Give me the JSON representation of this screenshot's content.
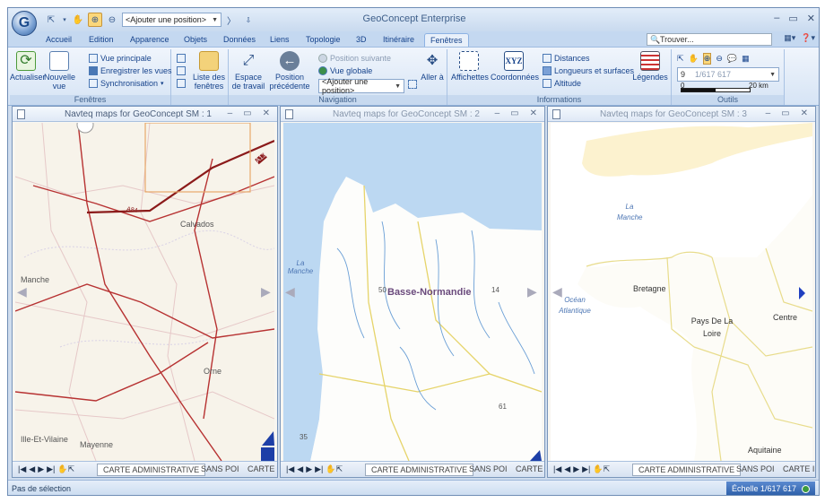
{
  "app": {
    "title": "GeoConcept Enterprise",
    "orb_letter": "G"
  },
  "qat": {
    "position_combo": "<Ajouter une position>"
  },
  "tabs": [
    "Accueil",
    "Edition",
    "Apparence",
    "Objets",
    "Données",
    "Liens",
    "Topologie",
    "3D",
    "Itinéraire",
    "Fenêtres"
  ],
  "active_tab": "Fenêtres",
  "search": {
    "placeholder": "Trouver..."
  },
  "ribbon": {
    "fenetres": {
      "label": "Fenêtres",
      "actualiser": "Actualiser",
      "nouvelle_vue": "Nouvelle vue",
      "vue_principale": "Vue principale",
      "enregistrer_vues": "Enregistrer les vues",
      "synchronisation": "Synchronisation",
      "liste_fenetres": "Liste des fenêtres"
    },
    "navigation": {
      "label": "Navigation",
      "espace_travail": "Espace de travail",
      "position_precedente": "Position précédente",
      "position_suivante": "Position suivante",
      "vue_globale": "Vue globale",
      "position_combo": "<Ajouter une position>",
      "aller_a": "Aller à"
    },
    "informations": {
      "label": "Informations",
      "affichettes": "Affichettes",
      "coordonnees": "Coordonnées",
      "xyz": "XYZ",
      "distances": "Distances",
      "longueurs_surfaces": "Longueurs et surfaces",
      "altitude": "Altitude",
      "legendes": "Légendes"
    },
    "outils": {
      "label": "Outils",
      "zoom_level": "9",
      "scale": "1/617 617",
      "scale_zero": "0",
      "scale_km": "20 km"
    }
  },
  "panes": [
    {
      "title": "Navteq maps for GeoConcept SM : 1",
      "labels": {
        "calvados": "Calvados",
        "manche": "Manche",
        "orne": "Orne",
        "ille": "Ille-Et-Vilaine",
        "mayenne": "Mayenne",
        "a84": "A84",
        "a13": "A13"
      },
      "tabs": [
        "CARTE ADMINISTRATIVE",
        "SANS POI",
        "CARTE I"
      ]
    },
    {
      "title": "Navteq maps for GeoConcept SM : 2",
      "labels": {
        "region": "Basse-Normandie",
        "la_manche": "La Manche",
        "n50": "50",
        "n14": "14",
        "n61": "61",
        "n35": "35"
      },
      "tabs": [
        "CARTE ADMINISTRATIVE",
        "SANS POI",
        "CARTE I"
      ]
    },
    {
      "title": "Navteq maps for GeoConcept SM : 3",
      "labels": {
        "la_manche": "La Manche",
        "ocean": "Océan Atlantique",
        "bretagne": "Bretagne",
        "pays_loire": "Pays De La Loire",
        "centre": "Centre",
        "aquitaine": "Aquitaine"
      },
      "tabs": [
        "CARTE ADMINISTRATIVE",
        "SANS POI",
        "CARTE I"
      ]
    }
  ],
  "status": {
    "selection": "Pas de sélection",
    "echelle": "Échelle 1/617 617"
  }
}
